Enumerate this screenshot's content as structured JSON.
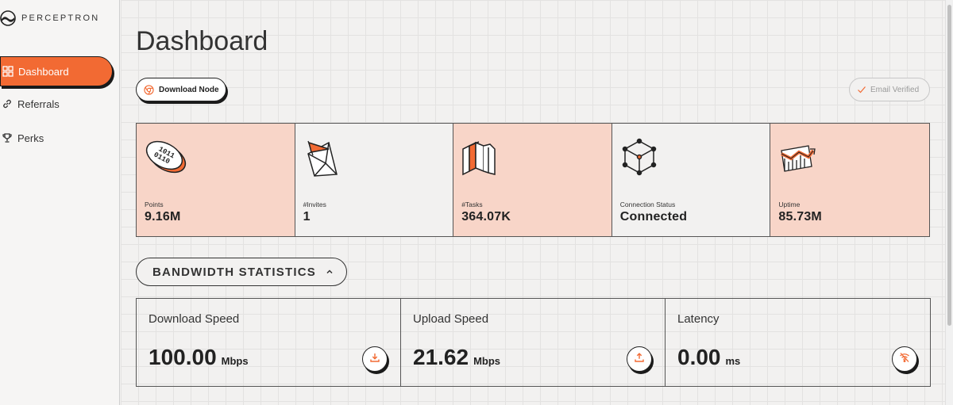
{
  "brand": {
    "name": "PERCEPTRON",
    "logo_icon": "perceptron-logo-icon"
  },
  "sidebar": {
    "items": [
      {
        "label": "Dashboard",
        "icon": "grid-icon",
        "active": true
      },
      {
        "label": "Referrals",
        "icon": "link-icon",
        "active": false
      },
      {
        "label": "Perks",
        "icon": "trophy-icon",
        "active": false
      }
    ]
  },
  "page": {
    "title": "Dashboard"
  },
  "actions": {
    "download_label": "Download Node",
    "download_icon": "chrome-icon",
    "verified_label": "Email Verified",
    "verified_icon": "check-icon"
  },
  "stats": [
    {
      "label": "Points",
      "value": "9.16M",
      "icon": "binary-coin-icon"
    },
    {
      "label": "#Invites",
      "value": "1",
      "icon": "envelope-flag-icon"
    },
    {
      "label": "#Tasks",
      "value": "364.07K",
      "icon": "books-icon"
    },
    {
      "label": "Connection Status",
      "value": "Connected",
      "icon": "cube-network-icon"
    },
    {
      "label": "Uptime",
      "value": "85.73M",
      "icon": "trend-chart-icon"
    }
  ],
  "bandwidth": {
    "section_title": "BANDWIDTH STATISTICS",
    "cards": [
      {
        "title": "Download Speed",
        "value": "100.00",
        "unit": "Mbps",
        "icon": "download-icon"
      },
      {
        "title": "Upload Speed",
        "value": "21.62",
        "unit": "Mbps",
        "icon": "upload-icon"
      },
      {
        "title": "Latency",
        "value": "0.00",
        "unit": "ms",
        "icon": "wifi-off-icon"
      }
    ]
  },
  "colors": {
    "accent": "#f26a33",
    "card_pink": "#f8d5c8",
    "background": "#f2f1f0"
  }
}
